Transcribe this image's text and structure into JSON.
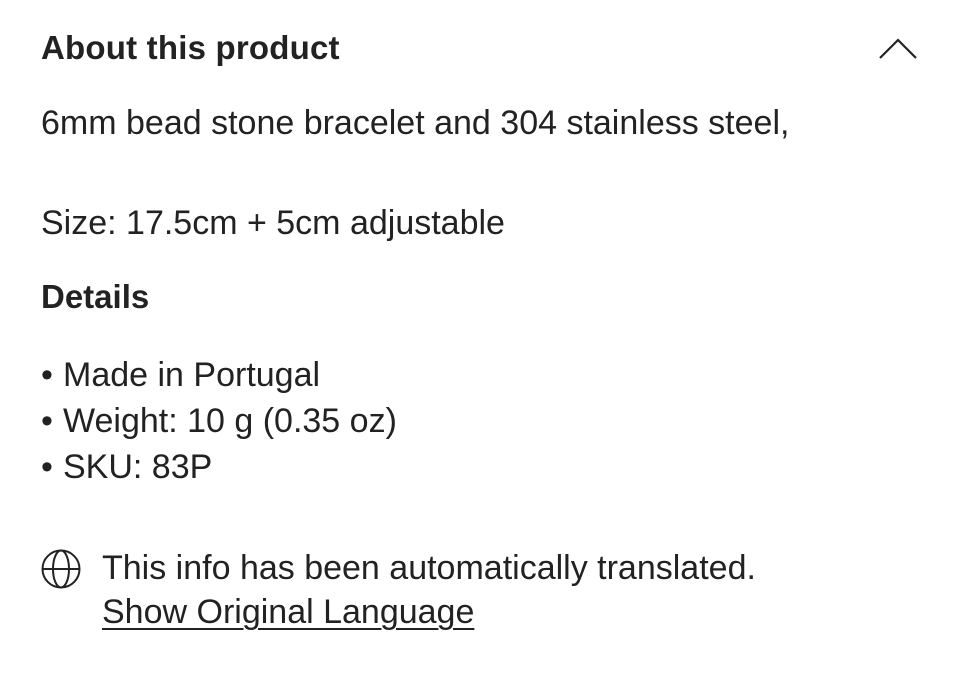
{
  "section": {
    "title": "About this product",
    "toggle_icon": "chevron-up-icon"
  },
  "description": {
    "text": "6mm bead stone bracelet and 304 stainless steel,\n\nSize: 17.5cm + 5cm adjustable"
  },
  "details": {
    "title": "Details",
    "bullet": "•",
    "items": [
      "Made in Portugal",
      "Weight: 10 g (0.35 oz)",
      "SKU: 83P"
    ]
  },
  "translation": {
    "icon": "globe-icon",
    "notice": "This info has been automatically translated.",
    "show_original_label": "Show Original Language"
  }
}
